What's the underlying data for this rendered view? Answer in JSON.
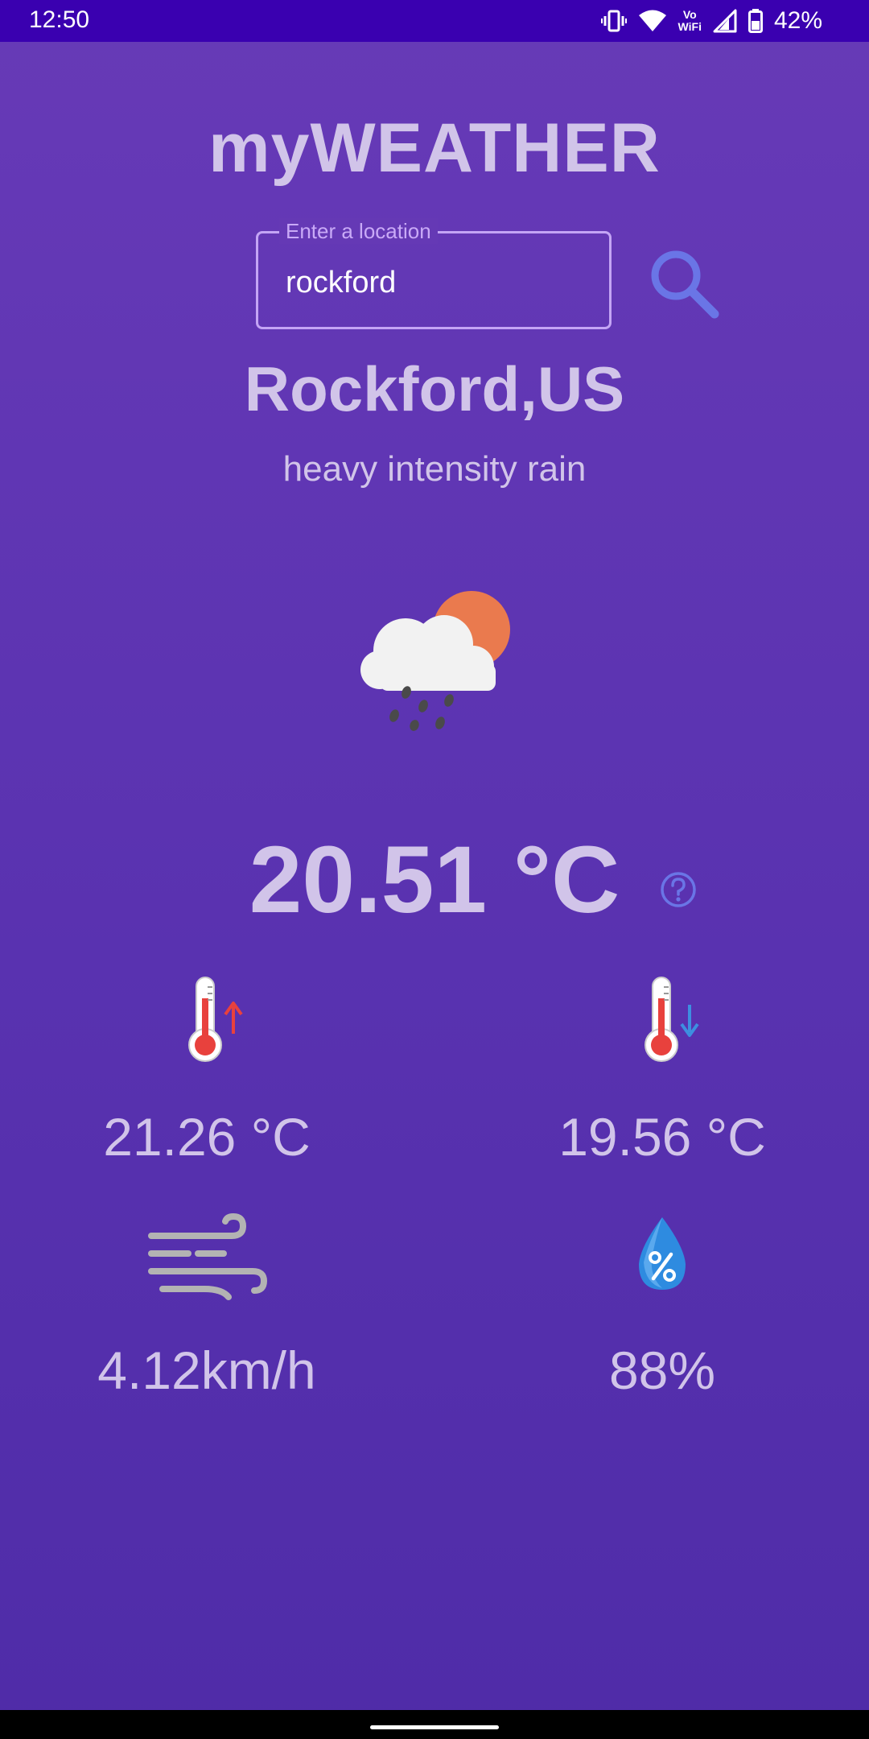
{
  "status_bar": {
    "time": "12:50",
    "vowifi": [
      "Vo",
      "WiFi"
    ],
    "battery": "42%",
    "icons": [
      "vibrate-icon",
      "wifi-icon",
      "vowifi-icon",
      "signal-icon",
      "battery-icon"
    ]
  },
  "app": {
    "title": "myWEATHER"
  },
  "search": {
    "label": "Enter a location",
    "value": "rockford",
    "button_icon": "search-icon"
  },
  "weather": {
    "city": "Rockford,US",
    "description": "heavy intensity rain",
    "condition_icon": "cloud-sun-rain-icon",
    "temperature": "20.51 °C",
    "help_icon": "help-icon"
  },
  "stats": {
    "max_temp": "21.26 °C",
    "min_temp": "19.56 °C",
    "wind_speed": "4.12km/h",
    "humidity": "88%"
  },
  "colors": {
    "status_bar": "#3a00b0",
    "background_top": "#673ab7",
    "background_bottom": "#4f2ca8",
    "text_primary": "#d1c4e9",
    "input_border": "#c4a5f5",
    "accent_blue": "#6a75e6"
  }
}
